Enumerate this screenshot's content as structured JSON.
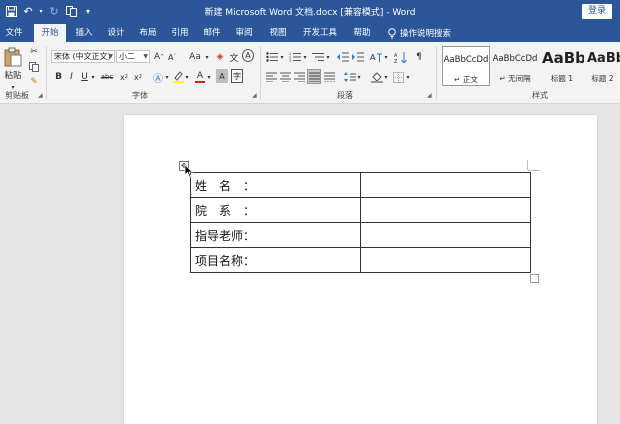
{
  "title_bar": {
    "title": "新建 Microsoft Word 文档.docx [兼容模式] - Word",
    "login": "登录",
    "qat": [
      "save-icon",
      "undo-icon",
      "redo-icon",
      "touch-mode-icon",
      "customize-icon"
    ]
  },
  "tabs": [
    "文件",
    "开始",
    "插入",
    "设计",
    "布局",
    "引用",
    "邮件",
    "审阅",
    "视图",
    "开发工具",
    "帮助"
  ],
  "active_tab": "开始",
  "tell_me": "操作说明搜索",
  "ribbon": {
    "clipboard": {
      "label": "剪贴板",
      "paste": "粘贴"
    },
    "font": {
      "label": "字体",
      "font_name": "宋体 (中文正文)",
      "font_size": "小二",
      "grow": "A",
      "shrink": "A",
      "change_case": "Aa",
      "bold": "B",
      "italic": "I",
      "underline": "U",
      "strike": "abc",
      "subscript": "x",
      "superscript": "x",
      "font_color": "A",
      "char_shading": "A",
      "phonetic": "文",
      "enclose": "A"
    },
    "paragraph": {
      "label": "段落"
    },
    "styles": {
      "label": "样式",
      "items": [
        {
          "sample": "AaBbCcDd",
          "name": "↵ 正文"
        },
        {
          "sample": "AaBbCcDd",
          "name": "↵ 无间隔"
        },
        {
          "sample": "AaBb",
          "name": "标题 1"
        },
        {
          "sample": "AaBb",
          "name": "标题 2"
        }
      ]
    }
  },
  "document": {
    "table": [
      [
        "姓　名　：",
        ""
      ],
      [
        "院　系　：",
        ""
      ],
      [
        "指导老师：",
        ""
      ],
      [
        "项目名称：",
        ""
      ]
    ]
  }
}
